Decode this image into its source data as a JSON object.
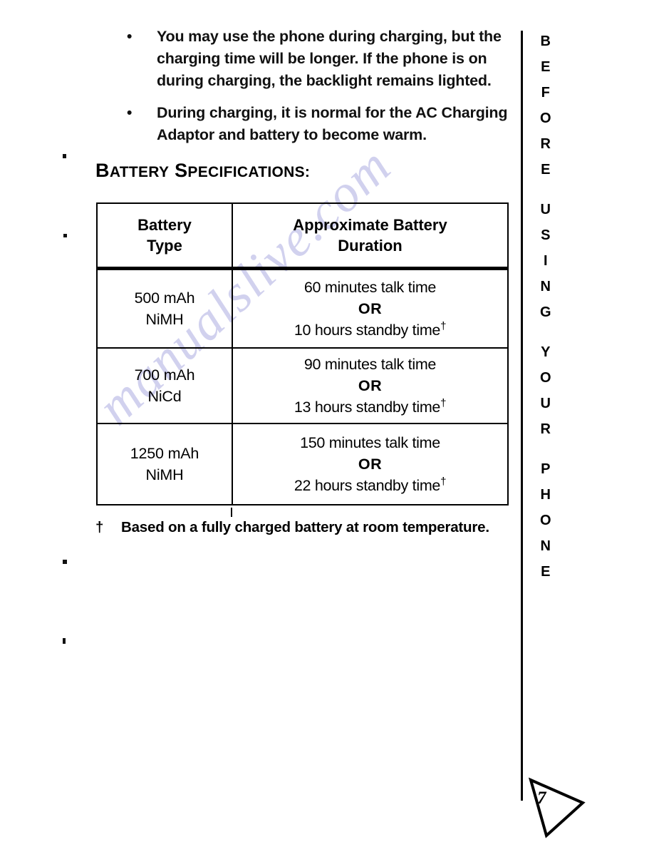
{
  "page": {
    "number": "7",
    "watermark": "manualslive.com"
  },
  "side_tab": {
    "text": "BEFORE USING YOUR PHONE",
    "words": [
      "BEFORE",
      "USING",
      "YOUR",
      "PHONE"
    ]
  },
  "notes": {
    "bullets": [
      "You may use the phone during charging, but the charging time will be longer. If the phone is on during charging, the backlight remains lighted.",
      "During charging, it is normal for the AC Charging Adaptor and battery to become warm."
    ],
    "bullet_marker": "•"
  },
  "heading": {
    "full": "BATTERY SPECIFICATIONS:",
    "part1_cap": "B",
    "part1_rest": "ATTERY",
    "part2_cap": "S",
    "part2_rest": "PECIFICATIONS:"
  },
  "table": {
    "headers": [
      {
        "line1": "Battery",
        "line2": "Type"
      },
      {
        "line1": "Approximate Battery",
        "line2": "Duration"
      }
    ],
    "rows": [
      {
        "type_line1": "500 mAh",
        "type_line2": "NiMH",
        "talk": "60 minutes talk time",
        "or": "OR",
        "standby": "10 hours standby time",
        "standby_mark": "†"
      },
      {
        "type_line1": "700 mAh",
        "type_line2": "NiCd",
        "talk": "90 minutes talk time",
        "or": "OR",
        "standby": "13 hours standby time",
        "standby_mark": "†"
      },
      {
        "type_line1": "1250 mAh",
        "type_line2": "NiMH",
        "talk": "150 minutes talk time",
        "or": "OR",
        "standby": "22 hours standby time",
        "standby_mark": "†"
      }
    ]
  },
  "footnote": {
    "mark": "†",
    "text": "Based on a fully charged battery at room temperature."
  }
}
